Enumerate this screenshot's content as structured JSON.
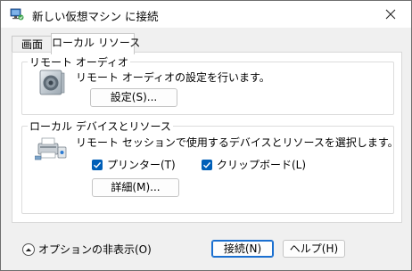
{
  "window": {
    "title": "新しい仮想マシン に接続"
  },
  "tabs": [
    {
      "label": "画面",
      "active": false
    },
    {
      "label": "ローカル リソース",
      "active": true
    }
  ],
  "remote_audio": {
    "group_title": "リモート オーディオ",
    "description": "リモート オーディオの設定を行います。",
    "settings_button": "設定(S)..."
  },
  "local_devices": {
    "group_title": "ローカル デバイスとリソース",
    "description": "リモート セッションで使用するデバイスとリソースを選択します。",
    "printer_label": "プリンター(T)",
    "printer_checked": true,
    "clipboard_label": "クリップボード(L)",
    "clipboard_checked": true,
    "details_button": "詳細(M)..."
  },
  "footer": {
    "options_toggle": "オプションの非表示(O)",
    "connect_button": "接続(N)",
    "help_button": "ヘルプ(H)"
  },
  "colors": {
    "accent": "#005fb8",
    "focus_border": "#1a6fd0"
  },
  "icons": [
    "remote-desktop-icon",
    "close-icon",
    "speaker-icon",
    "printer-devices-icon",
    "checkmark-icon",
    "chevron-up-icon"
  ]
}
